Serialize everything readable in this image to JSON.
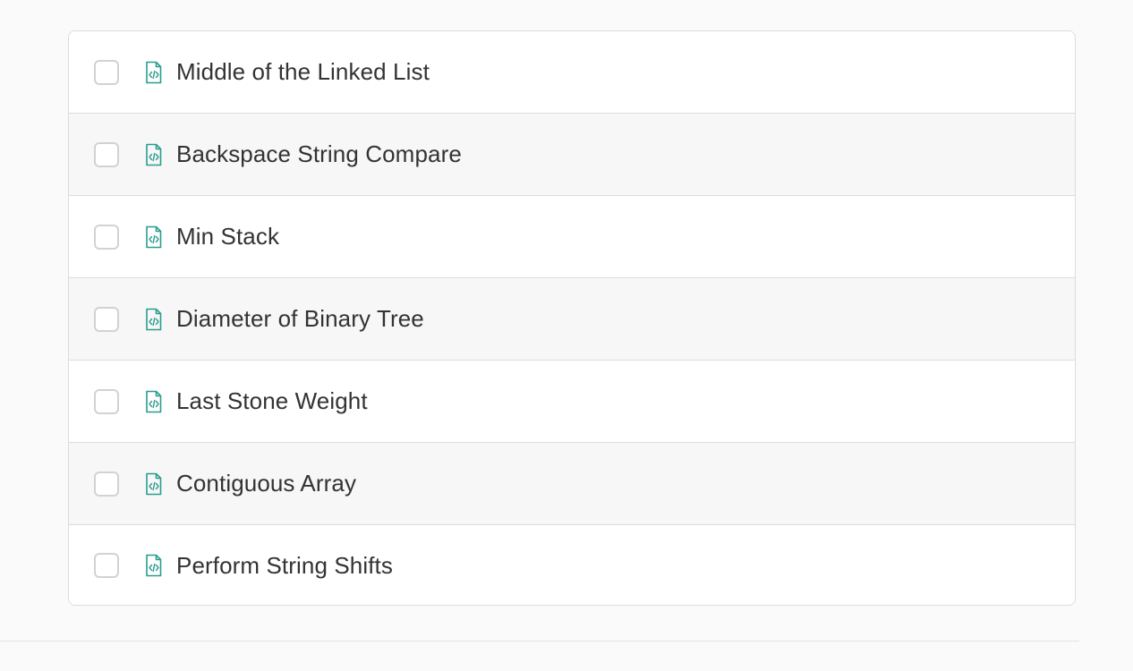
{
  "accent_color": "#2a9d8f",
  "problems": [
    {
      "title": "Middle of the Linked List",
      "checked": false,
      "icon": "code-file-icon"
    },
    {
      "title": "Backspace String Compare",
      "checked": false,
      "icon": "code-file-icon"
    },
    {
      "title": "Min Stack",
      "checked": false,
      "icon": "code-file-icon"
    },
    {
      "title": "Diameter of Binary Tree",
      "checked": false,
      "icon": "code-file-icon"
    },
    {
      "title": "Last Stone Weight",
      "checked": false,
      "icon": "code-file-icon"
    },
    {
      "title": "Contiguous Array",
      "checked": false,
      "icon": "code-file-icon"
    },
    {
      "title": "Perform String Shifts",
      "checked": false,
      "icon": "code-file-icon"
    }
  ]
}
